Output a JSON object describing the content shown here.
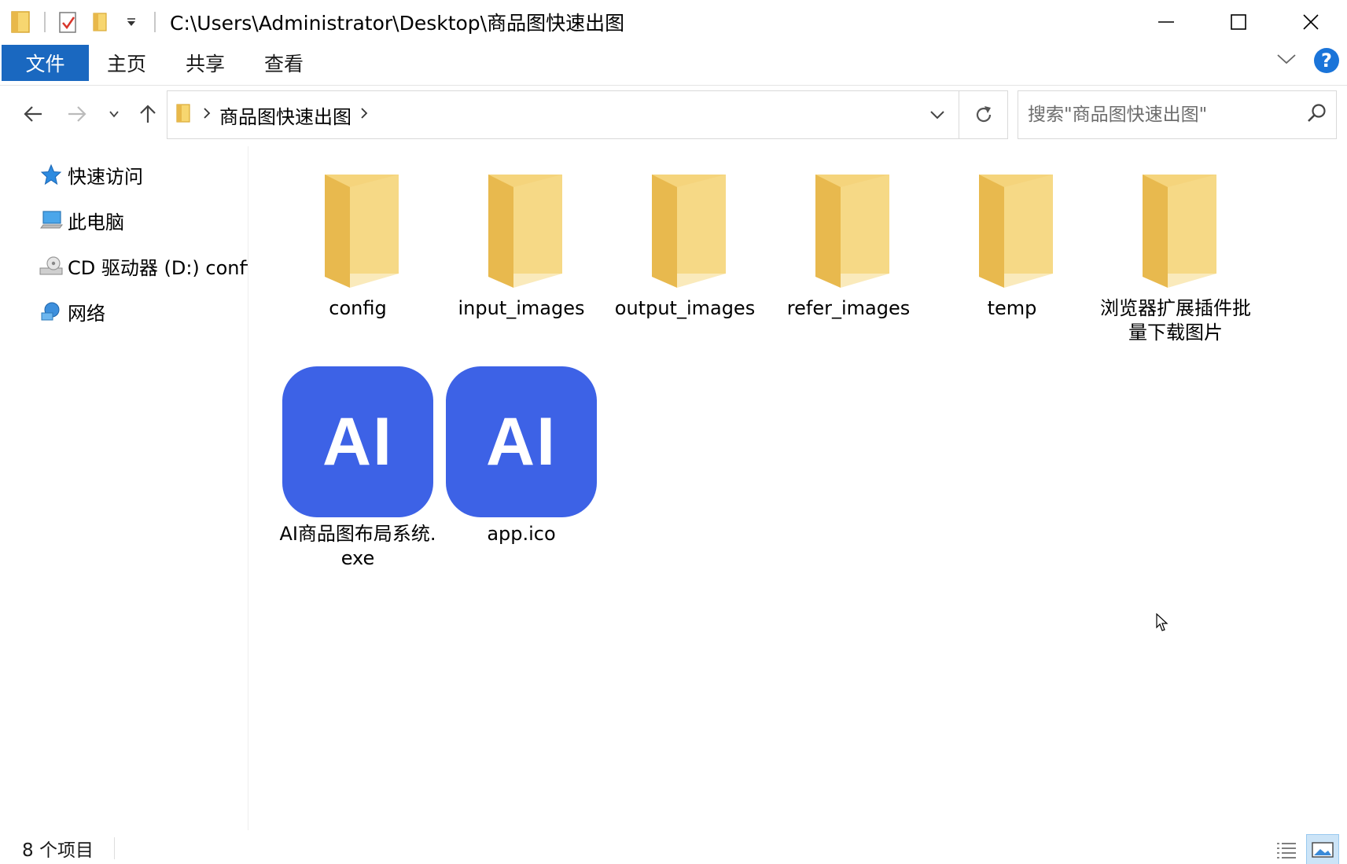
{
  "window": {
    "title": "C:\\Users\\Administrator\\Desktop\\商品图快速出图"
  },
  "ribbon": {
    "tabs": [
      {
        "label": "文件",
        "active": true
      },
      {
        "label": "主页"
      },
      {
        "label": "共享"
      },
      {
        "label": "查看"
      }
    ],
    "help_label": "?"
  },
  "navigation": {
    "breadcrumb": [
      "商品图快速出图"
    ],
    "search_placeholder": "搜索\"商品图快速出图\""
  },
  "sidebar": {
    "items": [
      {
        "label": "快速访问",
        "icon": "star-icon"
      },
      {
        "label": "此电脑",
        "icon": "computer-icon"
      },
      {
        "label": "CD 驱动器 (D:) config",
        "icon": "cd-drive-icon"
      },
      {
        "label": "网络",
        "icon": "network-icon"
      }
    ]
  },
  "files": {
    "items": [
      {
        "name": "config",
        "type": "folder"
      },
      {
        "name": "input_images",
        "type": "folder"
      },
      {
        "name": "output_images",
        "type": "folder"
      },
      {
        "name": "refer_images",
        "type": "folder"
      },
      {
        "name": "temp",
        "type": "folder"
      },
      {
        "name": "浏览器扩展插件批量下载图片",
        "type": "folder"
      },
      {
        "name": "AI商品图布局系统.exe",
        "type": "exe",
        "icon_text": "AI"
      },
      {
        "name": "app.ico",
        "type": "ico",
        "icon_text": "AI"
      }
    ]
  },
  "status": {
    "item_count": "8 个项目"
  },
  "colors": {
    "accent": "#1a68c0",
    "app_icon": "#3d62e6",
    "folder": "#f5cf62"
  }
}
